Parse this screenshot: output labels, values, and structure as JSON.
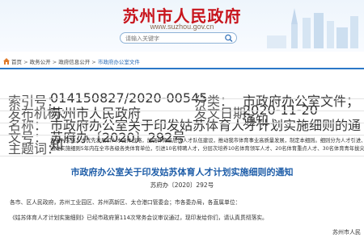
{
  "header": {
    "site_title": "苏州市人民政府",
    "site_url": "www.suzhou.gov.cn",
    "search_placeholder": "请输入关键字"
  },
  "breadcrumb": {
    "items": [
      "首页",
      "政务公开",
      "政府信息公开",
      "市政府办公室文件"
    ],
    "separator": ">"
  },
  "info": {
    "index_label": "索引号：",
    "index_value": "014150827/2020-00545",
    "category_label": "分类：",
    "category_value": "市政府办公室文件；通知",
    "org_label": "发布机构：",
    "org_value": "苏州市人民政府",
    "date_label": "发文日期：",
    "date_value": "2020-11-20",
    "name_label": "名称：",
    "name_value": "市政府办公室关于印发姑苏体育人才计划实施细则的通知",
    "docno_label": "文号：",
    "docno_value": "苏府办〔2020〕292号",
    "summary_label": "主题词：",
    "summary_line1": "为深入实施人才优先发展和人才强体战略，加强体育高层次人才队伍建设，推动我市体育事业高质量发展，制定本细则。细则分为人才引进、分层培养",
    "summary_line2": "通过实施细则5年内在全市各级各类体育单位，引进10名特聘人才，分层次培养10名体育领军人才、20名体育重点人才、30名体育青年拔尖人才。"
  },
  "article": {
    "title": "市政府办公室关于印发姑苏体育人才计划实施细则的通知",
    "doc_number": "苏府办〔2020〕292号",
    "salutation": "各市、区人民政府，苏州工业园区、苏州高新区、太仓港口管委会；市各委办局，各直属单位：",
    "body": "《姑苏体育人才计划实施细则》已经市政府第114次常务会议审议通过，现印发给你们，请认真贯彻落实。",
    "signature": "苏州市人民"
  },
  "colors": {
    "brand_red": "#c8151d",
    "link_blue": "#2a6bb5",
    "title_blue": "#1e5da8"
  }
}
